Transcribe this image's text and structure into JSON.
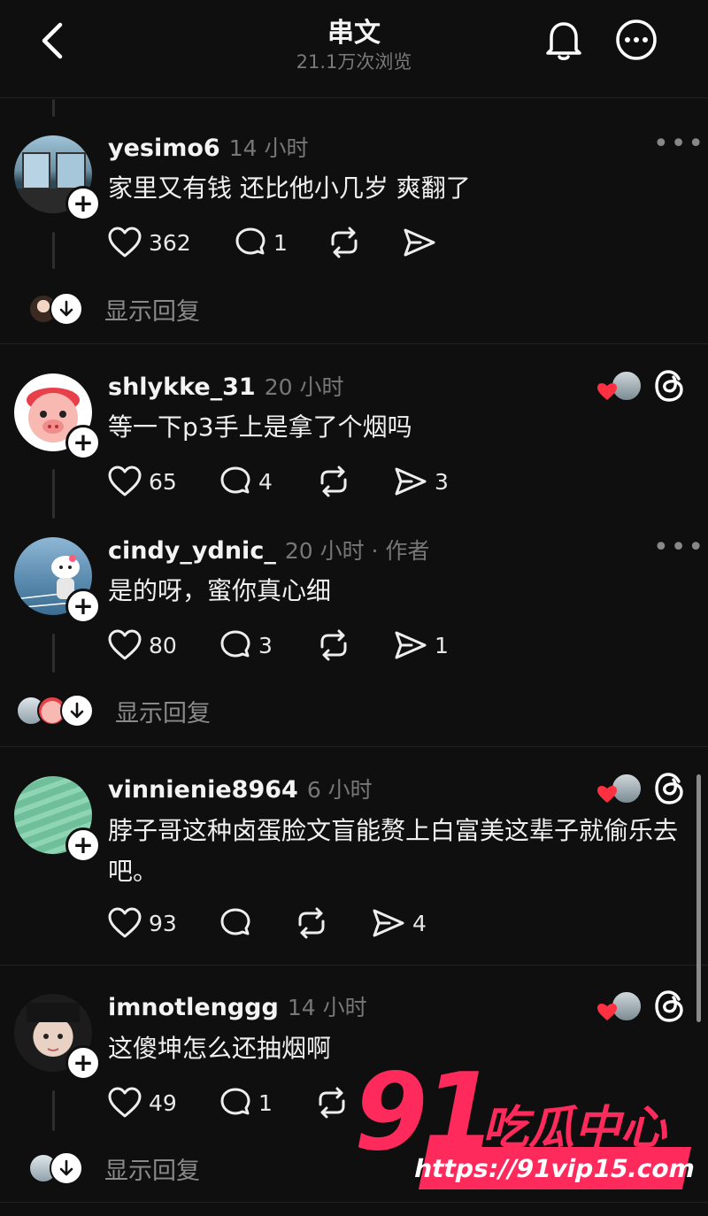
{
  "header": {
    "title": "串文",
    "views": "21.1万次浏览"
  },
  "icons": {
    "back": "chevron-left-icon",
    "bell": "bell-icon",
    "more": "more-circle-icon",
    "like": "heart-icon",
    "reply": "speech-bubble-icon",
    "repost": "repost-icon",
    "share": "send-icon",
    "threads": "threads-logo-icon"
  },
  "colors": {
    "background": "#0f0f0f",
    "accent": "#ff2a5c",
    "heart_badge": "#ff3040"
  },
  "comments": [
    {
      "username": "yesimo6",
      "time": "14 小时",
      "text": "家里又有钱 还比他小几岁 爽翻了",
      "likes": "362",
      "replies": "1",
      "shares": ""
    },
    {
      "username": "shlykke_31",
      "time": "20 小时",
      "text": "等一下p3手上是拿了个烟吗",
      "likes": "65",
      "replies": "4",
      "shares": "3"
    },
    {
      "username": "cindy_ydnic_",
      "time": "20 小时 · 作者",
      "text": "是的呀，蜜你真心细",
      "likes": "80",
      "replies": "3",
      "shares": "1"
    },
    {
      "username": "vinnienie8964",
      "time": "6 小时",
      "text": "脖子哥这种卤蛋脸文盲能赘上白富美这辈子就偷乐去吧。",
      "likes": "93",
      "replies": "",
      "shares": "4"
    },
    {
      "username": "imnotlenggg",
      "time": "14 小时",
      "text": "这傻坤怎么还抽烟啊",
      "likes": "49",
      "replies": "1",
      "shares": ""
    }
  ],
  "show_replies": "显示回复",
  "watermark": {
    "number": "91",
    "text": "吃瓜中心",
    "url": "https://91vip15.com"
  }
}
